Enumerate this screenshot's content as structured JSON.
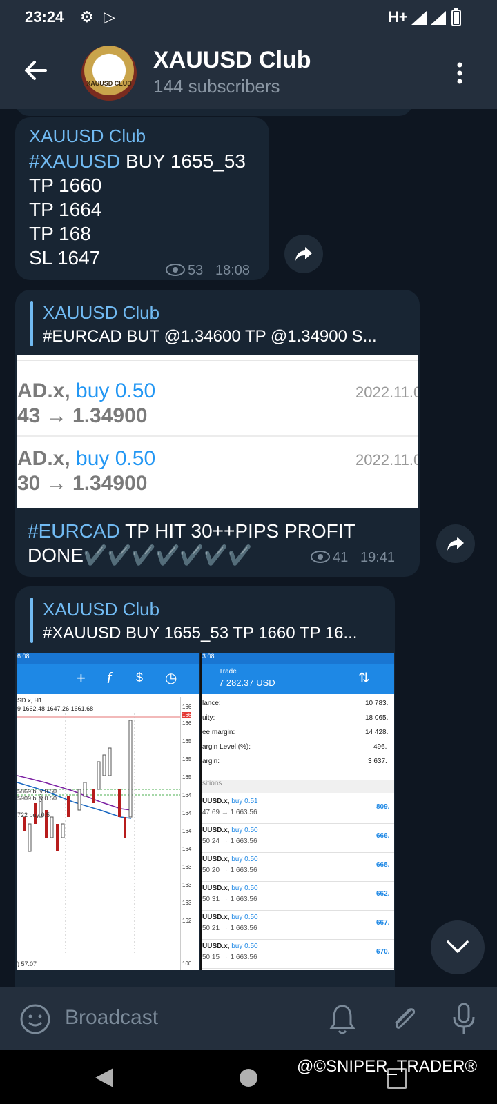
{
  "status": {
    "time": "23:24",
    "network": "H+"
  },
  "header": {
    "title": "XAUUSD Club",
    "subtitle": "144 subscribers",
    "avatar_text": "XAUUSD CLUB"
  },
  "messages": [
    {
      "sender": "XAUUSD Club",
      "hashtag": "#XAUUSD",
      "line1_rest": " BUY 1655_53",
      "lines": [
        "TP 1660",
        "TP 1664",
        "TP 168",
        "SL 1647"
      ],
      "views": "53",
      "time": "18:08"
    },
    {
      "reply_name": "XAUUSD Club",
      "reply_text": "#EURCAD BUT @1.34600 TP  @1.34900 S...",
      "screenshot": [
        {
          "symbol": "AD.x, ",
          "side": "buy 0.50",
          "prices": "43 → 1.34900",
          "date": "2022.11.0"
        },
        {
          "symbol": "AD.x, ",
          "side": "buy 0.50",
          "prices": "30 → 1.34900",
          "date": "2022.11.0"
        }
      ],
      "hashtag": "#EURCAD",
      "text_rest": " TP HIT 30++PIPS PROFIT",
      "text_line2": "DONE✔️✔️✔️✔️✔️✔️✔️",
      "views": "41",
      "time": "19:41"
    },
    {
      "reply_name": "XAUUSD Club",
      "reply_text": "#XAUUSD BUY 1655_53 TP 1660 TP 16...",
      "chart_panel": {
        "header_label": "6:08",
        "symbol": "SD.x, H1",
        "ohlc": "9 1662.48 1647.26 1661.68",
        "labels": [
          "5869 buy 0.50",
          "5909 buy 0.50",
          "722 buy 0.5"
        ],
        "bottom": ") 57.07",
        "axis": [
          "166",
          "166",
          "166",
          "165",
          "165",
          "165",
          "164",
          "164",
          "164",
          "164",
          "163",
          "163",
          "163",
          "162",
          "100"
        ]
      },
      "trade_panel": {
        "header_label": "3:08",
        "title": "Trade",
        "amount": "7 282.37 USD",
        "rows": [
          {
            "label": "lance:",
            "value": "10 783."
          },
          {
            "label": "uity:",
            "value": "18 065."
          },
          {
            "label": "ee margin:",
            "value": "14 428."
          },
          {
            "label": "argin Level (%):",
            "value": "496."
          },
          {
            "label": "argin:",
            "value": "3 637."
          }
        ],
        "section": "sitions",
        "positions": [
          {
            "sym": "UUSD.x, ",
            "side": "buy 0.51",
            "prices": "47.69 → 1 663.56",
            "pl": "809."
          },
          {
            "sym": "UUSD.x, ",
            "side": "buy 0.50",
            "prices": "50.24 → 1 663.56",
            "pl": "666."
          },
          {
            "sym": "UUSD.x, ",
            "side": "buy 0.50",
            "prices": "50.20 → 1 663.56",
            "pl": "668."
          },
          {
            "sym": "UUSD.x, ",
            "side": "buy 0.50",
            "prices": "50.31 → 1 663.56",
            "pl": "662."
          },
          {
            "sym": "UUSD.x, ",
            "side": "buy 0.50",
            "prices": "50.21 → 1 663.56",
            "pl": "667."
          },
          {
            "sym": "UUSD.x, ",
            "side": "buy 0.50",
            "prices": "50.15 → 1 663.56",
            "pl": "670."
          }
        ]
      }
    }
  ],
  "composer": {
    "placeholder": "Broadcast"
  },
  "watermark": "@©SNIPER_TRADER®",
  "colors": {
    "accent": "#71baf2",
    "bubble": "#182533",
    "header": "#242f3d"
  }
}
